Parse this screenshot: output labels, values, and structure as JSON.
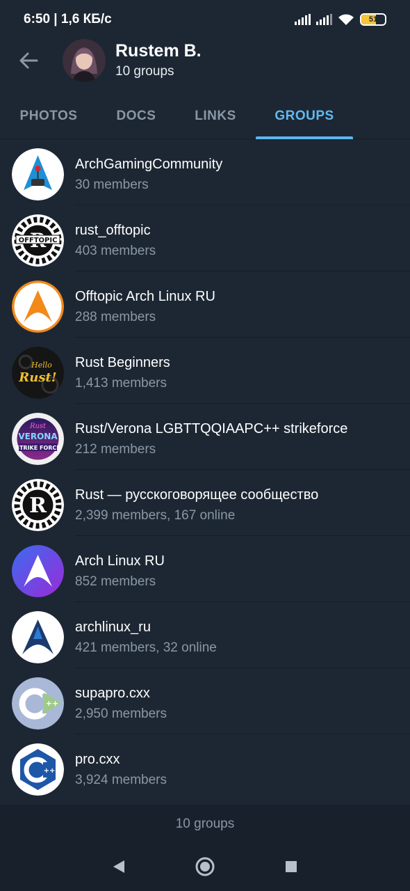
{
  "status_bar": {
    "time_speed": "6:50 | 1,6 КБ/с",
    "battery": "51"
  },
  "header": {
    "title": "Rustem B.",
    "subtitle": "10 groups"
  },
  "tabs": [
    {
      "label": "PHOTOS"
    },
    {
      "label": "DOCS"
    },
    {
      "label": "LINKS"
    },
    {
      "label": "GROUPS"
    }
  ],
  "groups": [
    {
      "name": "ArchGamingCommunity",
      "meta": "30 members"
    },
    {
      "name": "rust_offtopic",
      "meta": "403 members"
    },
    {
      "name": "Offtopic Arch Linux RU",
      "meta": "288 members"
    },
    {
      "name": "Rust Beginners",
      "meta": "1,413 members"
    },
    {
      "name": "Rust/Verona LGBTTQQIAAPC++ strikeforce",
      "meta": "212 members"
    },
    {
      "name": "Rust — русскоговорящее сообщество",
      "meta": "2,399 members, 167 online"
    },
    {
      "name": "Arch Linux RU",
      "meta": "852 members"
    },
    {
      "name": "archlinux_ru",
      "meta": "421 members, 32 online"
    },
    {
      "name": "supapro.cxx",
      "meta": "2,950 members"
    },
    {
      "name": "pro.cxx",
      "meta": "3,924 members"
    }
  ],
  "footer": {
    "count": "10 groups"
  },
  "colors": {
    "background": "#1d2733",
    "accent": "#62b8f0",
    "secondary_text": "#8a97a6"
  }
}
